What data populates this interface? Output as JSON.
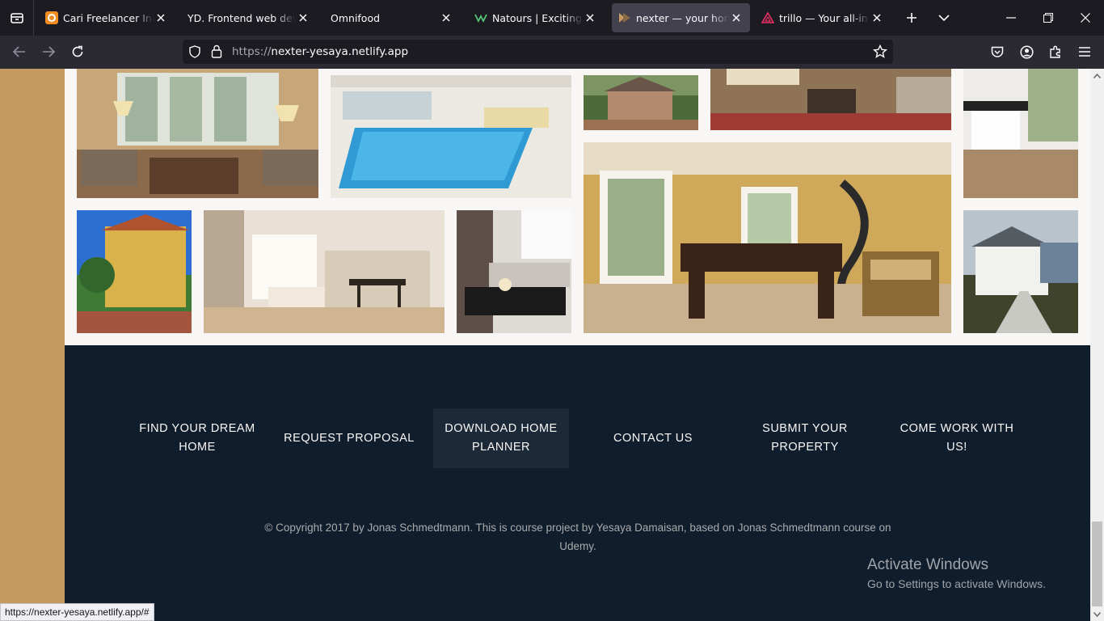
{
  "browser": {
    "tabs": [
      {
        "title": "Cari Freelancer Indonesia",
        "favicon": "projects-icon"
      },
      {
        "title": "YD. Frontend web developer",
        "favicon": "none"
      },
      {
        "title": "Omnifood",
        "favicon": "none"
      },
      {
        "title": "Natours | Exciting tours",
        "favicon": "natours-icon"
      },
      {
        "title": "nexter — your home, your freedom",
        "favicon": "nexter-icon",
        "active": true
      },
      {
        "title": "trillo — Your all-in-one booking app",
        "favicon": "trillo-icon"
      }
    ],
    "new_tab_icon": "plus-icon",
    "tab_overflow_icon": "chevron-down-icon",
    "url": {
      "protocol": "https://",
      "host": "nexter-yesaya.netlify.app"
    },
    "status_url": "https://nexter-yesaya.netlify.app/#"
  },
  "footer": {
    "links": [
      "Find your dream home",
      "Request proposal",
      "Download home planner",
      "Contact us",
      "Submit your property",
      "Come work with us!"
    ],
    "copyright": "© Copyright 2017 by Jonas Schmedtmann. This is course project by Yesaya Damaisan, based on Jonas Schmedtmann course on Udemy."
  },
  "watermark": {
    "title": "Activate Windows",
    "subtitle": "Go to Settings to activate Windows."
  },
  "colors": {
    "primary": "#c69963",
    "footer_bg": "#101d2c",
    "gallery_bg": "#f9f7f6"
  }
}
